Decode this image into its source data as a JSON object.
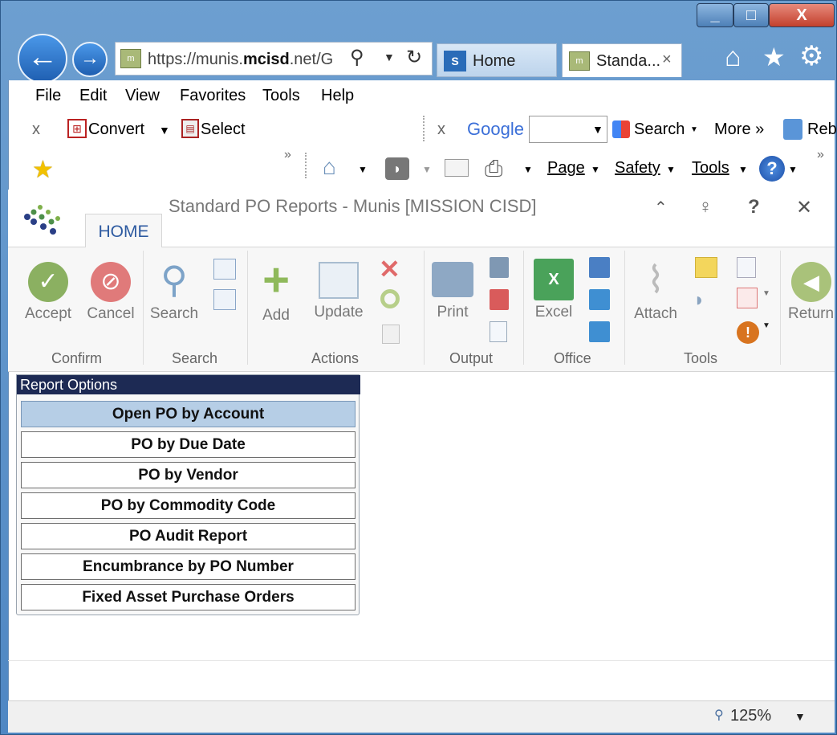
{
  "browser": {
    "address": "https://munis.mcisd.net/G",
    "address_bold": "mcisd",
    "tabs": [
      {
        "label": "Home"
      },
      {
        "label": "Standa...",
        "close": "×"
      }
    ],
    "window_controls": {
      "minimize": "_",
      "maximize": "□",
      "close": "X"
    },
    "menu": [
      "File",
      "Edit",
      "View",
      "Favorites",
      "Tools",
      "Help"
    ],
    "toolbar1": {
      "close_x": "x",
      "convert": "Convert",
      "select": "Select",
      "close_x2": "x",
      "google": "Google",
      "search": "Search",
      "more": "More »",
      "reb": "Reb",
      "overflow": "»"
    },
    "toolbar2": {
      "overflow": "»",
      "page": "Page",
      "safety": "Safety",
      "tools": "Tools",
      "overflow2": "»"
    },
    "zoom": "125%"
  },
  "app": {
    "title": "Standard PO Reports - Munis [MISSION CISD]",
    "tab": "HOME",
    "controls": {
      "help": "?",
      "close": "✕"
    }
  },
  "ribbon": {
    "groups": [
      {
        "label": "Confirm",
        "buttons": [
          "Accept",
          "Cancel"
        ]
      },
      {
        "label": "Search",
        "buttons": [
          "Search"
        ]
      },
      {
        "label": "Actions",
        "buttons": [
          "Add",
          "Update"
        ]
      },
      {
        "label": "Output",
        "buttons": [
          "Print"
        ]
      },
      {
        "label": "Office",
        "buttons": [
          "Excel"
        ]
      },
      {
        "label": "Tools",
        "buttons": [
          "Attach"
        ]
      },
      {
        "label": "",
        "buttons": [
          "Return"
        ]
      }
    ]
  },
  "report_options": {
    "title": "Report Options",
    "items": [
      "Open PO by Account",
      "PO by Due Date",
      "PO by Vendor",
      "PO by Commodity Code",
      "PO Audit Report",
      "Encumbrance by PO Number",
      "Fixed Asset Purchase Orders"
    ],
    "selected_index": 0
  },
  "colors": {
    "accent_blue": "#1f5fb1",
    "panel_title_bg": "#1d2a54",
    "selected_item_bg": "#b6cee6",
    "accept_green": "#8bb061",
    "cancel_red": "#e07a7a",
    "add_green": "#8fb95b"
  }
}
